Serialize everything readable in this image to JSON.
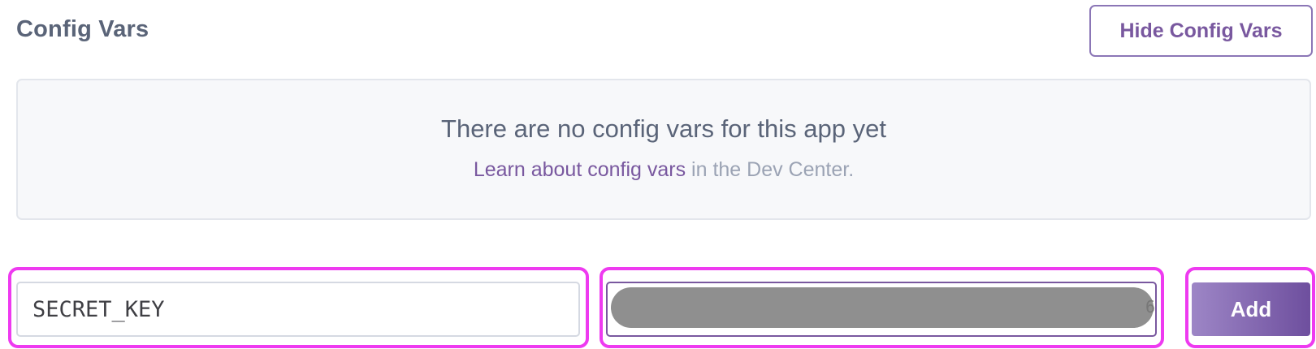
{
  "header": {
    "title": "Config Vars",
    "hide_button_label": "Hide Config Vars"
  },
  "empty_state": {
    "message": "There are no config vars for this app yet",
    "link_label": "Learn about config vars",
    "suffix_text": " in the Dev Center."
  },
  "form": {
    "key_value": "SECRET_KEY",
    "value_redacted": true,
    "value_tail": "6",
    "add_button_label": "Add"
  },
  "colors": {
    "accent": "#79589f",
    "title": "#5a6478",
    "highlight": "#ee3af0"
  }
}
